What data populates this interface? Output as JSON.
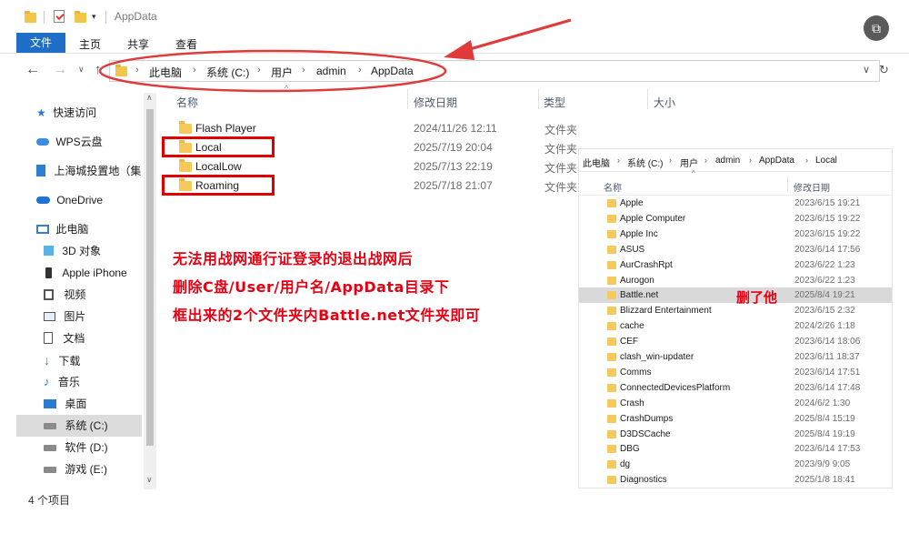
{
  "window": {
    "title": "AppData"
  },
  "ribbon": {
    "tabs": [
      "文件",
      "主页",
      "共享",
      "查看"
    ]
  },
  "address": {
    "crumbs": [
      "此电脑",
      "系统 (C:)",
      "用户",
      "admin",
      "AppData"
    ]
  },
  "nav": {
    "items": [
      {
        "label": "快速访问",
        "icon": "star-icon"
      },
      {
        "label": "WPS云盘",
        "icon": "cloud-icon"
      },
      {
        "label": "上海城投置地（集",
        "icon": "building-icon"
      },
      {
        "label": "OneDrive",
        "icon": "onedrive-icon"
      },
      {
        "label": "此电脑",
        "icon": "computer-icon"
      },
      {
        "label": "3D 对象",
        "icon": "cube-icon"
      },
      {
        "label": "Apple iPhone",
        "icon": "phone-icon"
      },
      {
        "label": "视频",
        "icon": "video-icon"
      },
      {
        "label": "图片",
        "icon": "picture-icon"
      },
      {
        "label": "文档",
        "icon": "document-icon"
      },
      {
        "label": "下载",
        "icon": "download-icon"
      },
      {
        "label": "音乐",
        "icon": "music-icon"
      },
      {
        "label": "桌面",
        "icon": "desktop-icon"
      },
      {
        "label": "系统 (C:)",
        "icon": "drive-icon"
      },
      {
        "label": "软件 (D:)",
        "icon": "drive-icon"
      },
      {
        "label": "游戏 (E:)",
        "icon": "drive-icon"
      }
    ]
  },
  "list": {
    "headers": {
      "name": "名称",
      "date": "修改日期",
      "type": "类型",
      "size": "大小"
    },
    "rows": [
      {
        "name": "Flash Player",
        "date": "2024/11/26 12:11",
        "type": "文件夹"
      },
      {
        "name": "Local",
        "date": "2025/7/19 20:04",
        "type": "文件夹"
      },
      {
        "name": "LocalLow",
        "date": "2025/7/13 22:19",
        "type": "文件夹"
      },
      {
        "name": "Roaming",
        "date": "2025/7/18 21:07",
        "type": "文件夹"
      }
    ]
  },
  "status": {
    "count": "4 个项目"
  },
  "annotation": {
    "lines": [
      "无法用战网通行证登录的退出战网后",
      "删除C盘/User/用户名/AppData目录下",
      "框出来的2个文件夹内Battle.net文件夹即可"
    ],
    "delete_label": "删了他"
  },
  "inset": {
    "crumbs": [
      "此电脑",
      "系统 (C:)",
      "用户",
      "admin",
      "AppData",
      "Local"
    ],
    "headers": {
      "name": "名称",
      "date": "修改日期"
    },
    "rows": [
      {
        "name": "Apple",
        "date": "2023/6/15 19:21"
      },
      {
        "name": "Apple Computer",
        "date": "2023/6/15 19:22"
      },
      {
        "name": "Apple Inc",
        "date": "2023/6/15 19:22"
      },
      {
        "name": "ASUS",
        "date": "2023/6/14 17:56"
      },
      {
        "name": "AurCrashRpt",
        "date": "2023/6/22 1:23"
      },
      {
        "name": "Aurogon",
        "date": "2023/6/22 1:23"
      },
      {
        "name": "Battle.net",
        "date": "2025/8/4 19:21"
      },
      {
        "name": "Blizzard Entertainment",
        "date": "2023/6/15 2:32"
      },
      {
        "name": "cache",
        "date": "2024/2/26 1:18"
      },
      {
        "name": "CEF",
        "date": "2023/6/14 18:06"
      },
      {
        "name": "clash_win-updater",
        "date": "2023/6/11 18:37"
      },
      {
        "name": "Comms",
        "date": "2023/6/14 17:51"
      },
      {
        "name": "ConnectedDevicesPlatform",
        "date": "2023/6/14 17:48"
      },
      {
        "name": "Crash",
        "date": "2024/6/2 1:30"
      },
      {
        "name": "CrashDumps",
        "date": "2025/8/4 15:19"
      },
      {
        "name": "D3DSCache",
        "date": "2025/8/4 19:19"
      },
      {
        "name": "DBG",
        "date": "2023/6/14 17:53"
      },
      {
        "name": "dg",
        "date": "2023/9/9 9:05"
      },
      {
        "name": "Diagnostics",
        "date": "2025/1/8 18:41"
      }
    ]
  },
  "colors": {
    "accent": "#1f6fc8",
    "annotation_red": "#e60012",
    "folder": "#f6c95c"
  }
}
